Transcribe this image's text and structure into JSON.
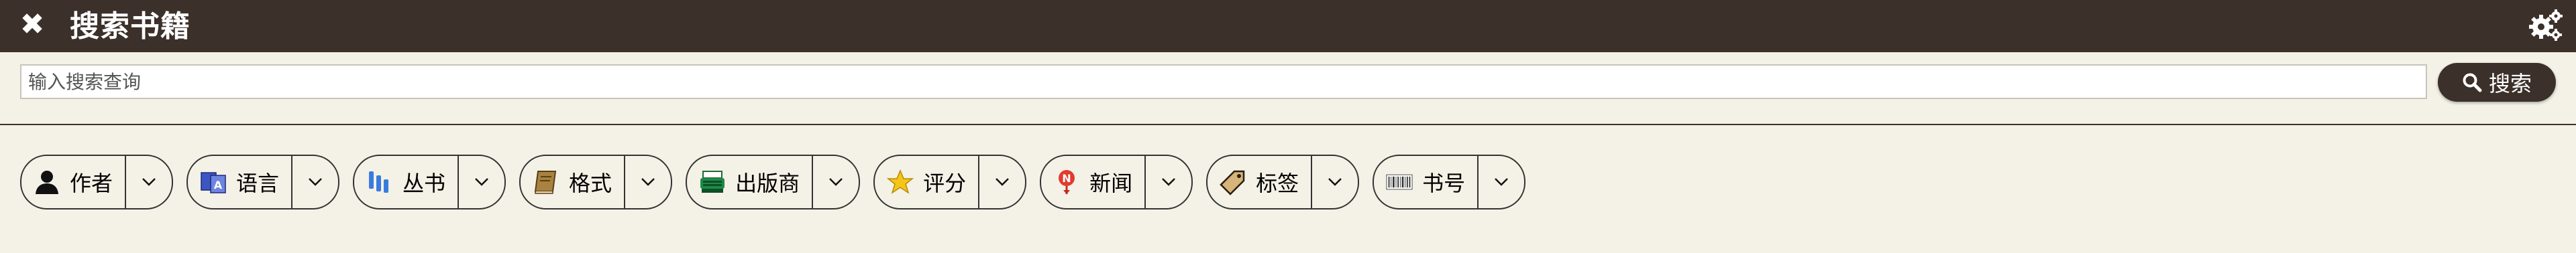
{
  "header": {
    "title": "搜索书籍",
    "close_icon": "close-icon",
    "settings_icon": "gear-icon"
  },
  "search": {
    "placeholder": "输入搜索查询",
    "value": "",
    "button_label": "搜索",
    "button_icon": "search-icon"
  },
  "facets": [
    {
      "label": "作者",
      "icon": "person-icon"
    },
    {
      "label": "语言",
      "icon": "language-icon"
    },
    {
      "label": "丛书",
      "icon": "series-icon"
    },
    {
      "label": "格式",
      "icon": "book-icon"
    },
    {
      "label": "出版商",
      "icon": "publisher-icon"
    },
    {
      "label": "评分",
      "icon": "star-icon"
    },
    {
      "label": "新闻",
      "icon": "news-icon"
    },
    {
      "label": "标签",
      "icon": "tag-icon"
    },
    {
      "label": "书号",
      "icon": "barcode-icon"
    }
  ],
  "colors": {
    "header_bg": "#3b302a",
    "page_bg": "#f4f1e6"
  }
}
